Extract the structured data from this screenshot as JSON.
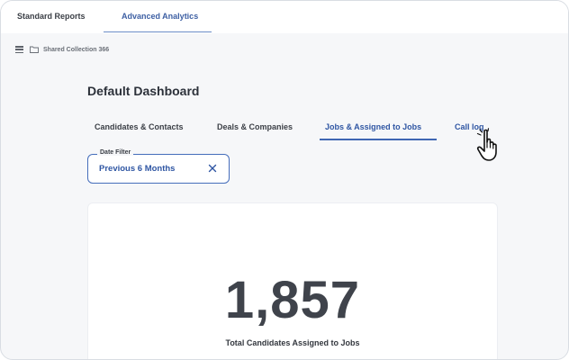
{
  "top_tabs": [
    {
      "label": "Standard Reports",
      "active": false
    },
    {
      "label": "Advanced Analytics",
      "active": true
    }
  ],
  "breadcrumb": {
    "menu_icon": "hamburger-icon",
    "folder_icon": "folder-icon",
    "collection": "Shared Collection 366"
  },
  "dashboard": {
    "title": "Default Dashboard",
    "tabs": [
      {
        "label": "Candidates & Contacts",
        "active": false
      },
      {
        "label": "Deals & Companies",
        "active": false
      },
      {
        "label": "Jobs & Assigned to Jobs",
        "active": true
      },
      {
        "label": "Call log",
        "active": false
      }
    ]
  },
  "date_filter": {
    "label": "Date Filter",
    "value": "Previous 6 Months",
    "clear_icon": "close-icon"
  },
  "metric": {
    "value": "1,857",
    "label": "Total Candidates Assigned to Jobs"
  },
  "cursor": {
    "icon": "hand-pointer-icon"
  },
  "colors": {
    "accent": "#2f56a3",
    "accent_border": "#456dbb",
    "text_dark": "#2c313a"
  }
}
